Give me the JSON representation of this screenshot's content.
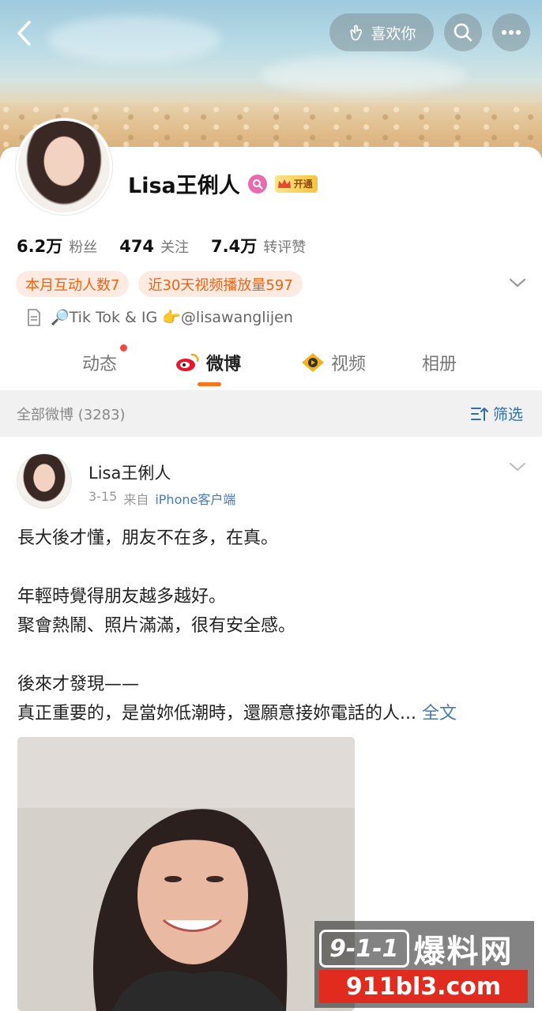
{
  "header": {
    "like_label": "喜欢你"
  },
  "profile": {
    "name": "Lisa王俐人",
    "vip_label": "开通",
    "stats": [
      {
        "value": "6.2万",
        "label": "粉丝"
      },
      {
        "value": "474",
        "label": "关注"
      },
      {
        "value": "7.4万",
        "label": "转评赞"
      }
    ],
    "tags": [
      "本月互动人数7",
      "近30天视频播放量597"
    ],
    "bio": "🔎Tik Tok & IG 👉@lisawanglijen"
  },
  "tabs": [
    {
      "label": "动态"
    },
    {
      "label": "微博"
    },
    {
      "label": "视频"
    },
    {
      "label": "相册"
    }
  ],
  "filter_bar": {
    "all_label": "全部微博 (3283)",
    "filter_label": "筛选"
  },
  "post": {
    "author": "Lisa王俐人",
    "date": "3-15",
    "from_label": "来自",
    "source": "iPhone客户端",
    "lines": [
      "長大後才懂，朋友不在多，在真。",
      "",
      "年輕時覺得朋友越多越好。",
      "聚會熱鬧、照片滿滿，很有安全感。",
      "",
      "後來才發現——",
      "真正重要的，是當妳低潮時，還願意接妳電話的人..."
    ],
    "more_label": "全文"
  },
  "watermark": {
    "badge": "9-1-1",
    "title": "爆料网",
    "domain": "911bl3.com"
  }
}
